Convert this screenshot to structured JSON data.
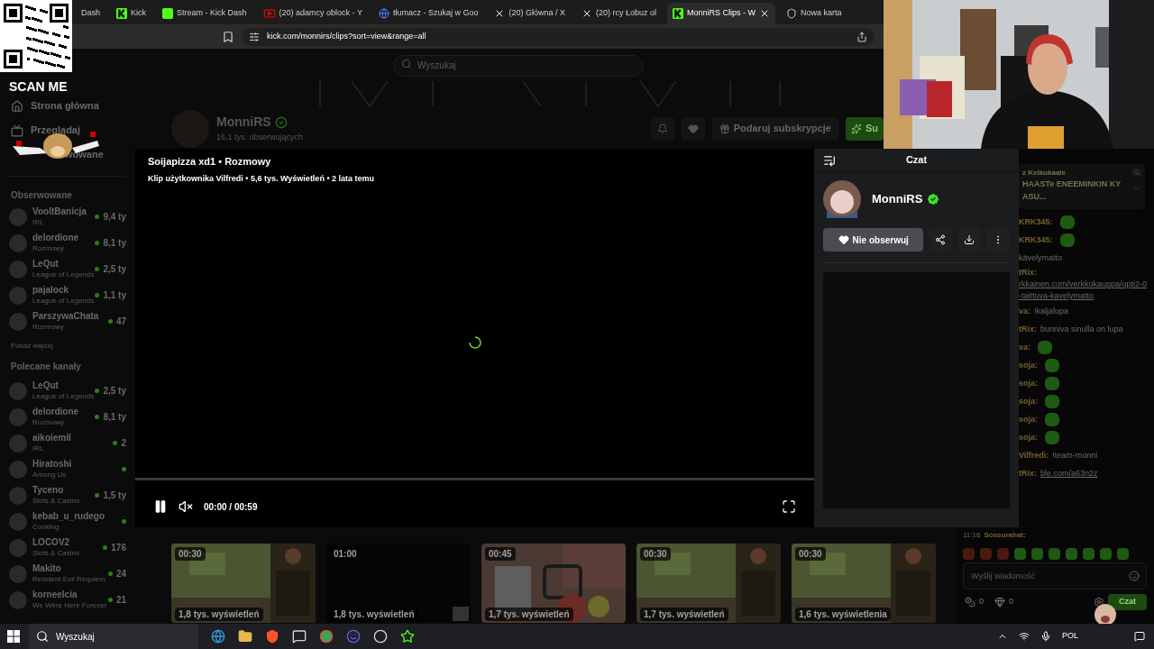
{
  "qr": {
    "caption": "SCAN ME"
  },
  "tabs": [
    {
      "label": "Dash",
      "kind": "plain",
      "selected": false
    },
    {
      "label": "Kick",
      "kind": "kick",
      "selected": false
    },
    {
      "label": "Stream - Kick Dash",
      "kind": "kick-muted",
      "selected": false
    },
    {
      "label": "(20) adamcy oblock - Y",
      "kind": "youtube",
      "selected": false
    },
    {
      "label": "tłumacz - Szukaj w Goo",
      "kind": "google",
      "selected": false
    },
    {
      "label": "(20) Główna / X",
      "kind": "x",
      "selected": false
    },
    {
      "label": "(20) rcy Łobuz ol",
      "kind": "x",
      "selected": false
    },
    {
      "label": "MonniRS Clips - W",
      "kind": "kick",
      "selected": true
    },
    {
      "label": "Nowa karta",
      "kind": "shield",
      "selected": false
    }
  ],
  "address": "kick.com/monnirs/clips?sort=view&range=all",
  "search": {
    "placeholder": "Wyszukaj"
  },
  "nav": [
    {
      "label": "Strona główna",
      "kind": "home"
    },
    {
      "label": "Przeglądaj",
      "kind": "browse"
    },
    {
      "label": "wowane",
      "kind": "plain"
    }
  ],
  "followed": {
    "title": "Obserwowane",
    "channels": [
      {
        "name": "VooltBanicja",
        "category": "IRL",
        "viewers": "9,4 ty"
      },
      {
        "name": "delordione",
        "category": "Rozmowy",
        "viewers": "8,1 ty"
      },
      {
        "name": "LeQut",
        "category": "League of Legends",
        "viewers": "2,5 ty"
      },
      {
        "name": "pajalock",
        "category": "League of Legends",
        "viewers": "1,1 ty"
      },
      {
        "name": "ParszywaChata",
        "category": "Rozmowy",
        "viewers": "47"
      }
    ],
    "more": "Pokaż więcej"
  },
  "recommended": {
    "title": "Polecane kanały",
    "channels": [
      {
        "name": "LeQut",
        "category": "League of Legends",
        "viewers": "2,5 ty"
      },
      {
        "name": "delordione",
        "category": "Rozmowy",
        "viewers": "8,1 ty"
      },
      {
        "name": "aikoiemil",
        "category": "IRL",
        "viewers": "2"
      },
      {
        "name": "Hiratoshi",
        "category": "Among Us"
      },
      {
        "name": "Tyceno",
        "category": "Slots & Casino",
        "viewers": "1,5 ty"
      },
      {
        "name": "kebab_u_rudego",
        "category": "Cooking"
      },
      {
        "name": "LOCOV2",
        "category": "Slots & Casino",
        "viewers": "176"
      },
      {
        "name": "Makito",
        "category": "Resident Evil Requiem",
        "viewers": "24"
      },
      {
        "name": "korneelcia",
        "category": "We Were Here Forever",
        "viewers": "21"
      }
    ]
  },
  "channel": {
    "name": "MonniRS",
    "followers": "16,1 tys. obserwujących",
    "gift": "Podaruj subskrypcje",
    "subscribe": "Su"
  },
  "clip": {
    "title": "Soijapizza xd1 • Rozmowy",
    "meta": "Klip użytkownika Vilfredi • 5,6 tys. Wyświetleń • 2 lata temu",
    "playing": true,
    "muted": true,
    "level": 0,
    "time": "00:00 / 00:59"
  },
  "clip_panel": {
    "title": "Czat",
    "name": "MonniRS",
    "unfollow": "Nie obserwuj"
  },
  "thumbnails": [
    {
      "duration": "00:30",
      "views": "1,8 tys. wyświetleń",
      "kind": "game"
    },
    {
      "duration": "01:00",
      "views": "1,8 tys. wyświetleń",
      "kind": "dark"
    },
    {
      "duration": "00:45",
      "views": "1,7 tys. wyświetleń",
      "kind": "food"
    },
    {
      "duration": "00:30",
      "views": "1,7 tys. wyświetleń",
      "kind": "game"
    },
    {
      "duration": "00:30",
      "views": "1,6 tys. wyświetlenia",
      "kind": "game"
    }
  ],
  "chat": {
    "pinned_user": "z Keikukaale",
    "pinned_text": "HAASTe ENEEMINKIN KY ASU...",
    "messages": [
      {
        "user": "KRK345:",
        "kind": "emote"
      },
      {
        "user": "KRK345:",
        "kind": "emote"
      },
      {
        "text": "kävelymatto",
        "kind": "text"
      },
      {
        "user": "tRix:",
        "text": "rkkainen.com/verkkokauppa/opti2-0-taittuva-kavelymatto",
        "kind": "link"
      },
      {
        "user": "va:",
        "text": "!kaljalupa",
        "kind": "text"
      },
      {
        "user": "tRix:",
        "text": "bunniva sinulla on lupa",
        "kind": "text"
      },
      {
        "user": "va:",
        "kind": "emote"
      },
      {
        "user": "soja:",
        "kind": "emote"
      },
      {
        "user": "soja:",
        "kind": "emote"
      },
      {
        "user": "soja:",
        "kind": "emote"
      },
      {
        "user": "soja:",
        "kind": "emote"
      },
      {
        "user": "soja:",
        "kind": "emote"
      },
      {
        "user": "Vilfredi:",
        "text": "!team-monni",
        "kind": "text"
      },
      {
        "user": "tRix:",
        "text": "ble.com/a63n2z",
        "kind": "link"
      }
    ],
    "last_time": "11:16",
    "last_user": "Sossurahat:",
    "placeholder": "Wyślij wiadomość",
    "points": "0",
    "drops": "0",
    "send": "Czat"
  },
  "taskbar": {
    "search": "Wyszukaj",
    "language": "POL"
  }
}
